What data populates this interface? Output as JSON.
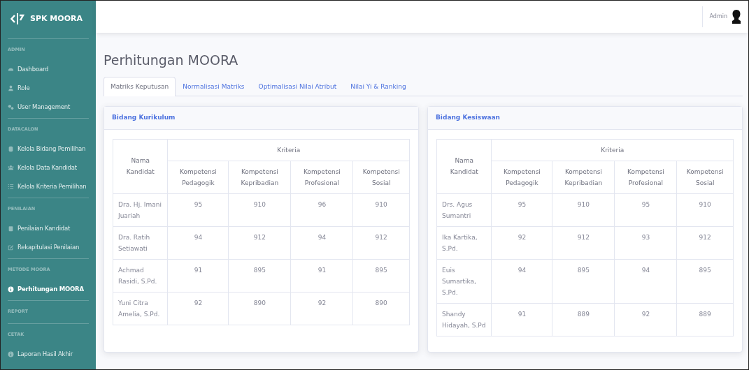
{
  "brand": {
    "title": "SPK MOORA"
  },
  "sidebar": {
    "sections": [
      {
        "heading": "ADMIN",
        "items": [
          {
            "label": "Dashboard",
            "selected": false
          },
          {
            "label": "Role",
            "selected": false
          },
          {
            "label": "User Management",
            "selected": false
          }
        ]
      },
      {
        "heading": "DATACALON",
        "items": [
          {
            "label": "Kelola Bidang Pemilihan",
            "selected": false
          },
          {
            "label": "Kelola Data Kandidat",
            "selected": false
          },
          {
            "label": "Kelola Kriteria Pemilihan",
            "selected": false
          }
        ]
      },
      {
        "heading": "PENILAIAN",
        "items": [
          {
            "label": "Penilaian Kandidat",
            "selected": false
          },
          {
            "label": "Rekapitulasi Penilaian",
            "selected": false
          }
        ]
      },
      {
        "heading": "METODE MOORA",
        "items": [
          {
            "label": "Perhitungan MOORA",
            "selected": true
          }
        ]
      },
      {
        "heading": "REPORT"
      },
      {
        "heading": "CETAK",
        "items": [
          {
            "label": "Laporan Hasil Akhir",
            "selected": false
          }
        ]
      }
    ]
  },
  "topbar": {
    "user": "Admin"
  },
  "page": {
    "title": "Perhitungan MOORA"
  },
  "tabs": [
    {
      "label": "Matriks Keputusan",
      "selected": true
    },
    {
      "label": "Normalisasi Matriks",
      "selected": false
    },
    {
      "label": "Optimalisasi Nilai Atribut",
      "selected": false
    },
    {
      "label": "Nilai Yi & Ranking",
      "selected": false
    }
  ],
  "cards": [
    {
      "title": "Bidang Kurikulum",
      "table": {
        "name_header": "Nama Kandidat",
        "group_header": "Kriteria",
        "columns": [
          "Kompetensi Pedagogik",
          "Kompetensi Kepribadian",
          "Kompetensi Profesional",
          "Kompetensi Sosial"
        ],
        "rows": [
          {
            "name": "Dra. Hj. Imani Juariah",
            "values": [
              "95",
              "910",
              "96",
              "910"
            ]
          },
          {
            "name": "Dra. Ratih Setiawati",
            "values": [
              "94",
              "912",
              "94",
              "912"
            ]
          },
          {
            "name": "Achmad Rasidi, S.Pd.",
            "values": [
              "91",
              "895",
              "91",
              "895"
            ]
          },
          {
            "name": "Yuni Citra Amelia, S.Pd.",
            "values": [
              "92",
              "890",
              "92",
              "890"
            ]
          }
        ]
      }
    },
    {
      "title": "Bidang Kesiswaan",
      "table": {
        "name_header": "Nama Kandidat",
        "group_header": "Kriteria",
        "columns": [
          "Kompetensi Pedagogik",
          "Kompetensi Kepribadian",
          "Kompetensi Profesional",
          "Kompetensi Sosial"
        ],
        "rows": [
          {
            "name": "Drs. Agus Sumantri",
            "values": [
              "95",
              "910",
              "95",
              "910"
            ]
          },
          {
            "name": "Ika Kartika, S.Pd.",
            "values": [
              "92",
              "912",
              "93",
              "912"
            ]
          },
          {
            "name": "Euis Sumartika, S.Pd.",
            "values": [
              "94",
              "895",
              "94",
              "895"
            ]
          },
          {
            "name": "Shandy Hidayah, S.Pd",
            "values": [
              "91",
              "889",
              "92",
              "889"
            ]
          }
        ]
      }
    }
  ]
}
